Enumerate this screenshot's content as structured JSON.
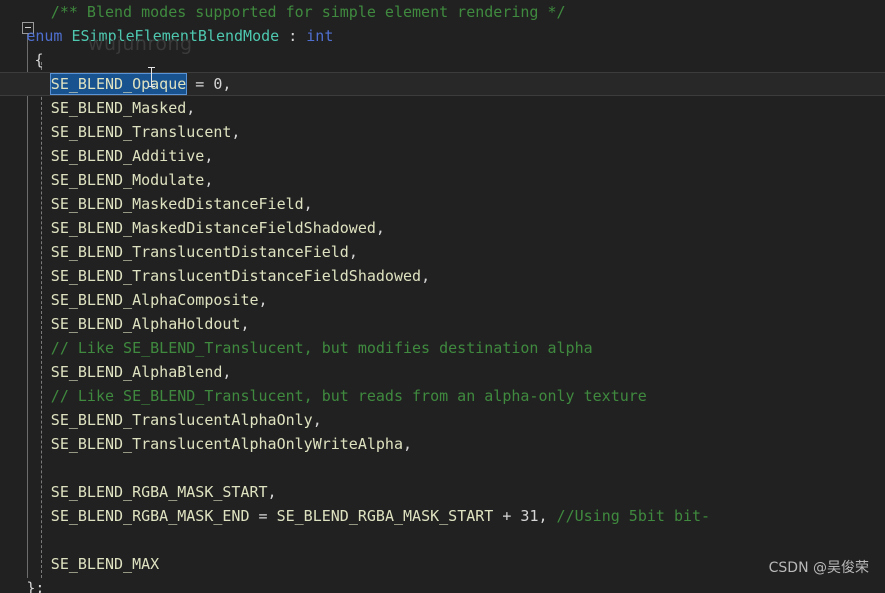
{
  "app": {
    "kind": "code-editor",
    "theme": "dark",
    "background": "#212121"
  },
  "colors": {
    "background": "#212121",
    "comment": "#3f8a3f",
    "keyword": "#4f6fd0",
    "type_name": "#4ec9b0",
    "identifier": "#dfe2c0",
    "punctuation": "#d6d6d6",
    "selection_background": "#19538f",
    "selection_border": "#5a94d6",
    "current_line_background": "#282828",
    "fold_rail": "#6d6d6d",
    "indent_guide": "#7b7b7b",
    "watermark_user": "#3a3a3a",
    "watermark_csdn": "#b9b9b9"
  },
  "gutter": {
    "fold_toggle": "collapse-minus",
    "fold_toggle_state": "expanded"
  },
  "watermarks": {
    "user": "wujunrong",
    "csdn": "CSDN @吴俊荣"
  },
  "selection": {
    "text": "SE_BLEND_Opaque",
    "line_index": 3
  },
  "code": {
    "language": "cpp",
    "lines": [
      {
        "indent": 5,
        "current": false,
        "tokens": [
          {
            "t": "/** Blend modes supported for simple element rendering */",
            "c": "cmt"
          }
        ]
      },
      {
        "indent": 2,
        "current": false,
        "tokens": [
          {
            "t": "enum ",
            "c": "kw"
          },
          {
            "t": "ESimpleElementBlendMode",
            "c": "type"
          },
          {
            "t": " : ",
            "c": "pun"
          },
          {
            "t": "int",
            "c": "kw"
          }
        ]
      },
      {
        "indent": 3,
        "current": false,
        "tokens": [
          {
            "t": "{",
            "c": "pun"
          }
        ]
      },
      {
        "indent": 5,
        "current": true,
        "tokens": [
          {
            "t": "SE_BLEND_Opaque",
            "c": "sel"
          },
          {
            "t": " = ",
            "c": "pun"
          },
          {
            "t": "0",
            "c": "num"
          },
          {
            "t": ",",
            "c": "pun"
          }
        ]
      },
      {
        "indent": 5,
        "current": false,
        "tokens": [
          {
            "t": "SE_BLEND_Masked",
            "c": "id"
          },
          {
            "t": ",",
            "c": "pun"
          }
        ]
      },
      {
        "indent": 5,
        "current": false,
        "tokens": [
          {
            "t": "SE_BLEND_Translucent",
            "c": "id"
          },
          {
            "t": ",",
            "c": "pun"
          }
        ]
      },
      {
        "indent": 5,
        "current": false,
        "tokens": [
          {
            "t": "SE_BLEND_Additive",
            "c": "id"
          },
          {
            "t": ",",
            "c": "pun"
          }
        ]
      },
      {
        "indent": 5,
        "current": false,
        "tokens": [
          {
            "t": "SE_BLEND_Modulate",
            "c": "id"
          },
          {
            "t": ",",
            "c": "pun"
          }
        ]
      },
      {
        "indent": 5,
        "current": false,
        "tokens": [
          {
            "t": "SE_BLEND_MaskedDistanceField",
            "c": "id"
          },
          {
            "t": ",",
            "c": "pun"
          }
        ]
      },
      {
        "indent": 5,
        "current": false,
        "tokens": [
          {
            "t": "SE_BLEND_MaskedDistanceFieldShadowed",
            "c": "id"
          },
          {
            "t": ",",
            "c": "pun"
          }
        ]
      },
      {
        "indent": 5,
        "current": false,
        "tokens": [
          {
            "t": "SE_BLEND_TranslucentDistanceField",
            "c": "id"
          },
          {
            "t": ",",
            "c": "pun"
          }
        ]
      },
      {
        "indent": 5,
        "current": false,
        "tokens": [
          {
            "t": "SE_BLEND_TranslucentDistanceFieldShadowed",
            "c": "id"
          },
          {
            "t": ",",
            "c": "pun"
          }
        ]
      },
      {
        "indent": 5,
        "current": false,
        "tokens": [
          {
            "t": "SE_BLEND_AlphaComposite",
            "c": "id"
          },
          {
            "t": ",",
            "c": "pun"
          }
        ]
      },
      {
        "indent": 5,
        "current": false,
        "tokens": [
          {
            "t": "SE_BLEND_AlphaHoldout",
            "c": "id"
          },
          {
            "t": ",",
            "c": "pun"
          }
        ]
      },
      {
        "indent": 5,
        "current": false,
        "tokens": [
          {
            "t": "// Like SE_BLEND_Translucent, but modifies destination alpha",
            "c": "cmt"
          }
        ]
      },
      {
        "indent": 5,
        "current": false,
        "tokens": [
          {
            "t": "SE_BLEND_AlphaBlend",
            "c": "id"
          },
          {
            "t": ",",
            "c": "pun"
          }
        ]
      },
      {
        "indent": 5,
        "current": false,
        "tokens": [
          {
            "t": "// Like SE_BLEND_Translucent, but reads from an alpha-only texture",
            "c": "cmt"
          }
        ]
      },
      {
        "indent": 5,
        "current": false,
        "tokens": [
          {
            "t": "SE_BLEND_TranslucentAlphaOnly",
            "c": "id"
          },
          {
            "t": ",",
            "c": "pun"
          }
        ]
      },
      {
        "indent": 5,
        "current": false,
        "tokens": [
          {
            "t": "SE_BLEND_TranslucentAlphaOnlyWriteAlpha",
            "c": "id"
          },
          {
            "t": ",",
            "c": "pun"
          }
        ]
      },
      {
        "indent": 0,
        "current": false,
        "tokens": []
      },
      {
        "indent": 5,
        "current": false,
        "tokens": [
          {
            "t": "SE_BLEND_RGBA_MASK_START",
            "c": "id"
          },
          {
            "t": ",",
            "c": "pun"
          }
        ]
      },
      {
        "indent": 5,
        "current": false,
        "tokens": [
          {
            "t": "SE_BLEND_RGBA_MASK_END",
            "c": "id"
          },
          {
            "t": " = ",
            "c": "pun"
          },
          {
            "t": "SE_BLEND_RGBA_MASK_START",
            "c": "id"
          },
          {
            "t": " + ",
            "c": "pun"
          },
          {
            "t": "31",
            "c": "num"
          },
          {
            "t": ", ",
            "c": "pun"
          },
          {
            "t": "//Using 5bit bit-",
            "c": "cmt"
          }
        ]
      },
      {
        "indent": 0,
        "current": false,
        "tokens": []
      },
      {
        "indent": 5,
        "current": false,
        "tokens": [
          {
            "t": "SE_BLEND_MAX",
            "c": "id"
          }
        ]
      },
      {
        "indent": 2,
        "current": false,
        "tokens": [
          {
            "t": "};",
            "c": "pun"
          }
        ]
      }
    ]
  }
}
